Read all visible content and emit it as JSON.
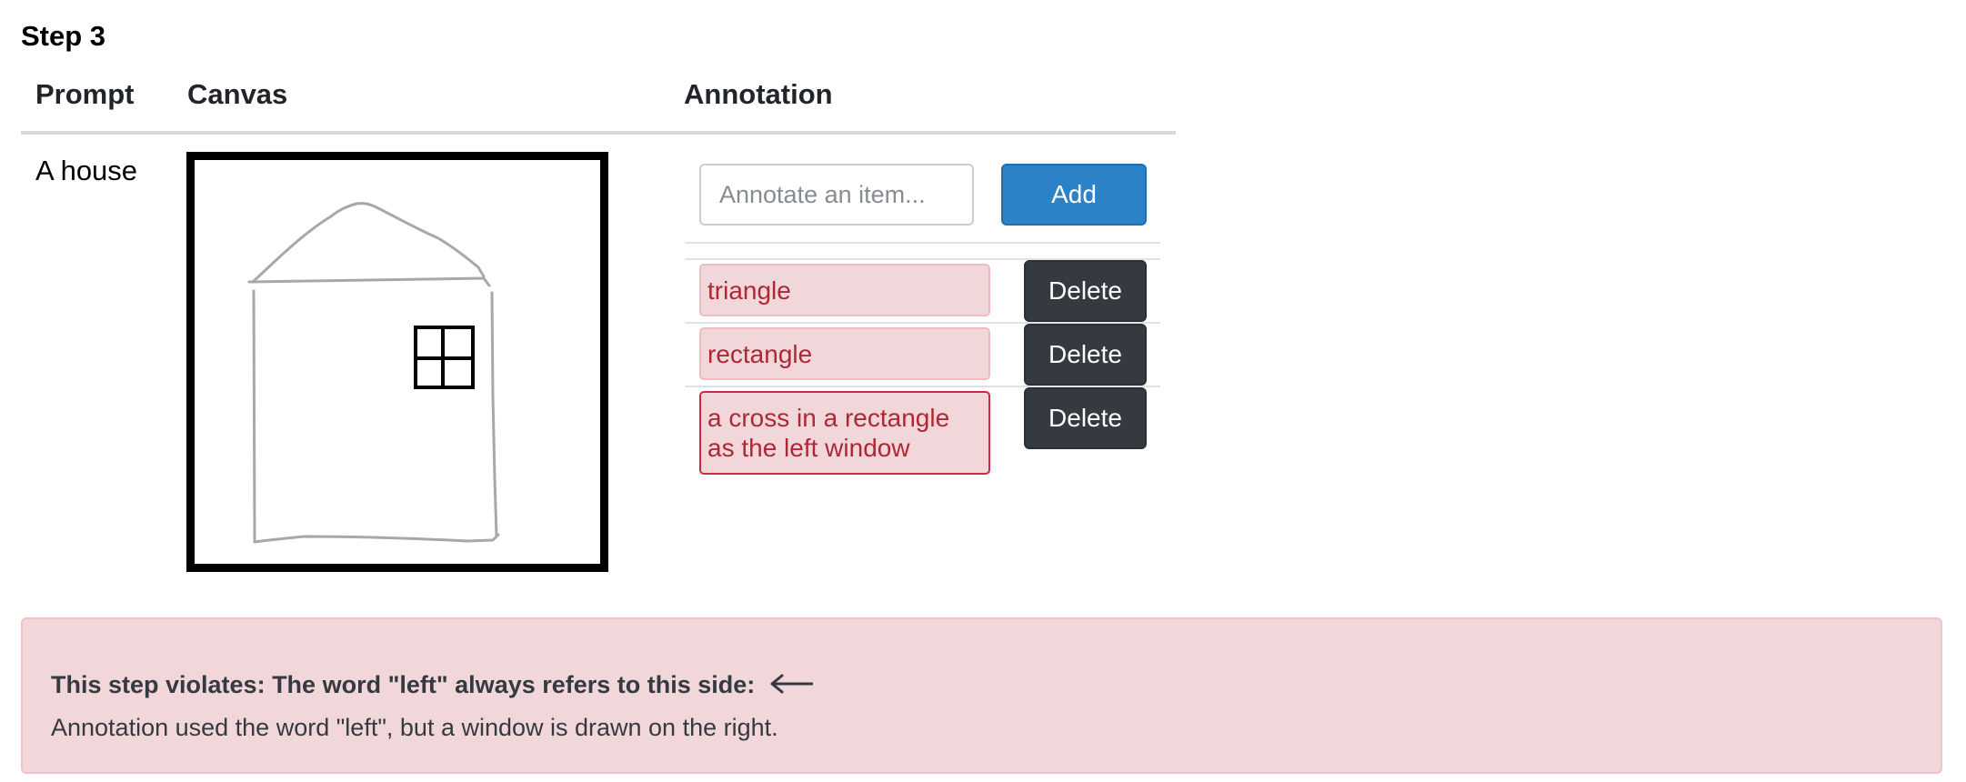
{
  "step": {
    "title": "Step 3"
  },
  "table": {
    "headers": {
      "prompt": "Prompt",
      "canvas": "Canvas",
      "annotation": "Annotation"
    },
    "prompt_text": "A house"
  },
  "annotation": {
    "input": {
      "value": "",
      "placeholder": "Annotate an item..."
    },
    "add_label": "Add",
    "items": [
      {
        "label": "triangle",
        "delete_label": "Delete"
      },
      {
        "label": "rectangle",
        "delete_label": "Delete"
      },
      {
        "label": "a cross in a rectangle as the left window",
        "delete_label": "Delete"
      }
    ]
  },
  "alert": {
    "title": "This step violates: The word \"left\" always refers to this side:",
    "title_icon": "left-arrow-icon",
    "message": "Annotation used the word \"left\", but a window is drawn on the right."
  },
  "colors": {
    "primary": "#2d82c7",
    "dark_button": "#343a40",
    "danger_text": "#ad2835",
    "danger_bg": "#f2d7da",
    "invalid_border": "#cf2a44"
  }
}
